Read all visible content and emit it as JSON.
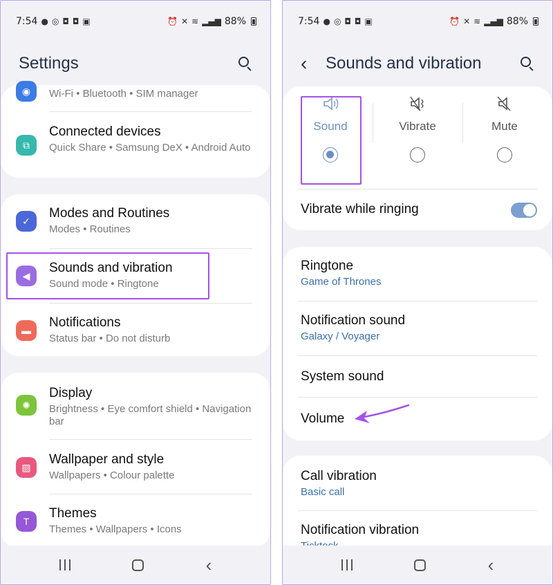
{
  "left": {
    "status": {
      "time": "7:54",
      "battery": "88%"
    },
    "title": "Settings",
    "groups": [
      {
        "items": [
          {
            "title": "",
            "subtitle": "Wi-Fi  •  Bluetooth  •  SIM manager",
            "icon": "wifi-icon",
            "color": "#3d7be5"
          },
          {
            "title": "Connected devices",
            "subtitle": "Quick Share  •  Samsung DeX  •  Android Auto",
            "icon": "connected-devices-icon",
            "color": "#37b8ad"
          }
        ]
      },
      {
        "items": [
          {
            "title": "Modes and Routines",
            "subtitle": "Modes  •  Routines",
            "icon": "modes-routines-icon",
            "color": "#4c67d8"
          },
          {
            "title": "Sounds and vibration",
            "subtitle": "Sound mode  •  Ringtone",
            "icon": "volume-icon",
            "color": "#9a6de2"
          },
          {
            "title": "Notifications",
            "subtitle": "Status bar  •  Do not disturb",
            "icon": "notifications-icon",
            "color": "#ef6a5a"
          }
        ]
      },
      {
        "items": [
          {
            "title": "Display",
            "subtitle": "Brightness  •  Eye comfort shield  •  Navigation bar",
            "icon": "display-icon",
            "color": "#7dc43a"
          },
          {
            "title": "Wallpaper and style",
            "subtitle": "Wallpapers  •  Colour palette",
            "icon": "wallpaper-icon",
            "color": "#e9587f"
          },
          {
            "title": "Themes",
            "subtitle": "Themes  •  Wallpapers  •  Icons",
            "icon": "themes-icon",
            "color": "#9558d8"
          }
        ]
      }
    ]
  },
  "right": {
    "status": {
      "time": "7:54",
      "battery": "88%"
    },
    "title": "Sounds and vibration",
    "modes": [
      {
        "label": "Sound",
        "selected": true,
        "icon": "speaker-icon"
      },
      {
        "label": "Vibrate",
        "selected": false,
        "icon": "vibrate-icon"
      },
      {
        "label": "Mute",
        "selected": false,
        "icon": "mute-icon"
      }
    ],
    "vibrate_while_ringing": {
      "label": "Vibrate while ringing",
      "on": true
    },
    "group2": [
      {
        "title": "Ringtone",
        "subtitle": "Game of Thrones"
      },
      {
        "title": "Notification sound",
        "subtitle": "Galaxy / Voyager"
      },
      {
        "title": "System sound",
        "subtitle": ""
      },
      {
        "title": "Volume",
        "subtitle": ""
      }
    ],
    "group3": [
      {
        "title": "Call vibration",
        "subtitle": "Basic call"
      },
      {
        "title": "Notification vibration",
        "subtitle": "Ticktock"
      }
    ]
  },
  "colors": {
    "highlight": "#a552e8",
    "accent_blue": "#3a6fb0",
    "toggle_on": "#7c9fd0"
  }
}
